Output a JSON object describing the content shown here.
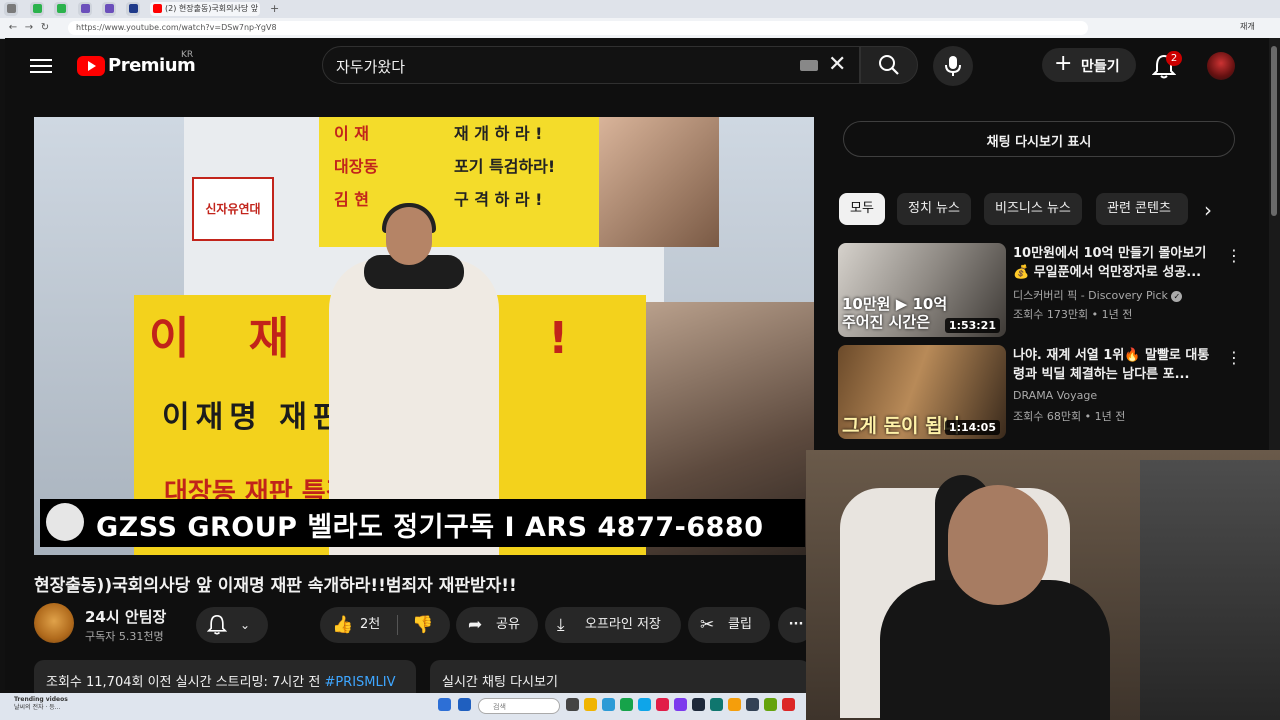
{
  "browser": {
    "tabs": [
      {
        "label": "",
        "color": "#7a7a7a"
      },
      {
        "label": "",
        "color": "#2bb24c"
      },
      {
        "label": "",
        "color": "#2bb24c"
      },
      {
        "label": "",
        "color": "#6b4fbb"
      },
      {
        "label": "",
        "color": "#6b4fbb"
      },
      {
        "label": "",
        "color": "#1f3a8a"
      },
      {
        "label": "",
        "color": "#222222"
      },
      {
        "label": "(2) 현장출동)국회의사당 앞",
        "color": "#ff0000"
      }
    ],
    "url": "https://www.youtube.com/watch?v=DSw7np-YgV8",
    "profile_label": "재개"
  },
  "header": {
    "logo_text": "Premium",
    "region": "KR",
    "search_query": "자두가왔다",
    "create_label": "만들기",
    "notification_count": "2"
  },
  "video": {
    "banner_top_lines": [
      "이 재",
      "대장동",
      "김 현"
    ],
    "banner_top_right": [
      "재 개 하 라 !",
      "포기 특검하라!",
      "구 격 하 라 !"
    ],
    "banner_main_red": "이 재 명 진 !",
    "banner_main_black": "이재명   재판   개하라!",
    "banner_main_bottom": "대장동 재판   특검하라",
    "caption": "GZSS GROUP 벨라도 정기구독 I ARS 4877-6880",
    "truck_label": "신자유연대"
  },
  "watch": {
    "title": "현장출동))국회의사당 앞 이재명 재판 속개하라!!범죄자 재판받자!!",
    "channel_name": "24시 안팀장",
    "subscribers": "구독자 5.31천명",
    "like_count": "2천",
    "share_label": "공유",
    "download_label": "오프라인 저장",
    "clip_label": "클립",
    "description_meta": "조회수 11,704회  이전 실시간 스트리밍: 7시간 전",
    "description_tag": "#PRISMLIV",
    "chat_replay_label": "실시간 채팅 다시보기"
  },
  "sidebar": {
    "show_chat_label": "채팅 다시보기 표시",
    "chips": [
      "모두",
      "정치 뉴스",
      "비즈니스 뉴스",
      "관련 콘텐츠"
    ],
    "recommendations": [
      {
        "title": "10만원에서 10억 만들기 몰아보기 💰 무일푼에서 억만장자로 성공...",
        "channel": "디스커버리 픽 - Discovery Pick",
        "meta": "조회수 173만회 • 1년 전",
        "duration": "1:53:21",
        "overlay": "10만원 ▶ 10억\n주어진 시간은"
      },
      {
        "title": "나야. 재계 서열 1위🔥 말빨로 대통령과 빅딜 체결하는 남다른 포...",
        "channel": "DRAMA Voyage",
        "meta": "조회수 68만회 • 1년 전",
        "duration": "1:14:05",
        "overlay": "그게 돈이 됩니"
      }
    ]
  },
  "taskbar": {
    "weather_title": "Trending videos",
    "weather_sub": "날씨의 전자 · 등...",
    "search_placeholder": "검색"
  },
  "colors": {
    "youtube_red": "#ff0000",
    "background": "#0f0f0f",
    "banner_yellow": "#f3d21c",
    "protest_red": "#c1231a",
    "link_blue": "#3ea6ff"
  }
}
